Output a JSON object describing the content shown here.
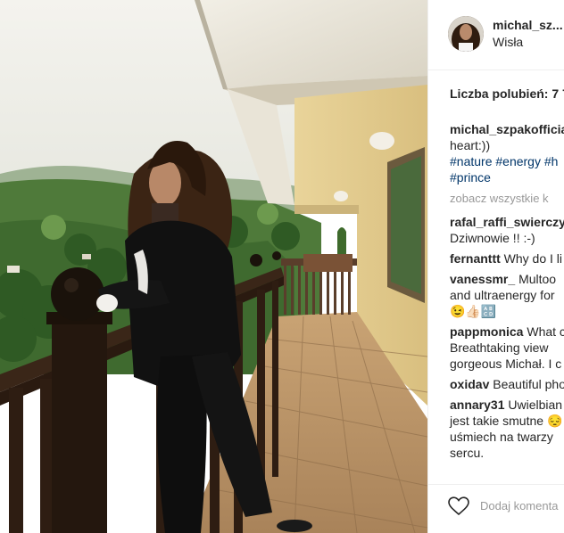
{
  "post": {
    "username": "michal_sz...",
    "location": "Wisła"
  },
  "likes_text": "Liczba polubień: 7 7",
  "comments": [
    {
      "user": "michal_szpakofficia",
      "lines": [
        "heart:))"
      ],
      "tags": [
        "#nature #energy #h",
        "#prince"
      ]
    },
    {
      "more": "zobacz wszystkie k"
    },
    {
      "user": "rafal_raffi_swierczy",
      "lines": [
        "Dziwnowie !! :-)"
      ]
    },
    {
      "user": "fernanttt",
      "text": "Why do I li"
    },
    {
      "user": "vanessmr_",
      "text": "Multoo",
      "lines": [
        "and ultraenergy for",
        "😉👍🏻🔠"
      ]
    },
    {
      "user": "pappmonica",
      "text": "What c",
      "lines": [
        "Breathtaking view",
        "gorgeous Michał. I c"
      ]
    },
    {
      "user": "oxidav",
      "text": "Beautiful pho"
    },
    {
      "user": "annary31",
      "text": "Uwielbian",
      "lines": [
        "jest takie smutne 😔",
        "uśmiech na twarzy",
        "sercu."
      ]
    }
  ],
  "footer": {
    "add_comment_placeholder": "Dodaj komenta",
    "heart_icon": "heart-outline-icon"
  },
  "colors": {
    "hashtag": "#003569",
    "muted": "#999999",
    "border": "#efefef"
  }
}
